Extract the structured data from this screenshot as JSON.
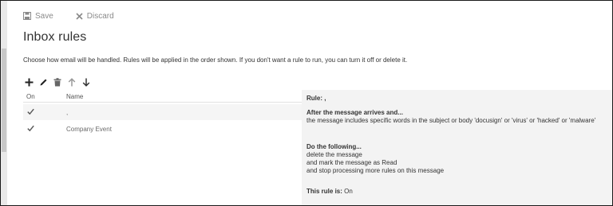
{
  "toolbar": {
    "save_label": "Save",
    "discard_label": "Discard"
  },
  "page": {
    "title": "Inbox rules",
    "description": "Choose how email will be handled. Rules will be applied in the order shown. If you don't want a rule to run, you can turn it off or delete it."
  },
  "rule_actions": {
    "icons": [
      "add-icon",
      "edit-icon",
      "delete-icon",
      "move-up-icon",
      "move-down-icon"
    ]
  },
  "grid": {
    "headers": {
      "on": "On",
      "name": "Name"
    },
    "rows": [
      {
        "on": true,
        "name": ","
      },
      {
        "on": true,
        "name": "Company Event"
      }
    ]
  },
  "detail": {
    "rule_label": "Rule: ,",
    "condition_heading": "After the message arrives and...",
    "condition_text": "the message includes specific words in the subject or body 'docusign' or 'virus' or 'hacked' or 'malware'",
    "action_heading": "Do the following...",
    "actions": [
      "delete the message",
      "and mark the message as Read",
      "and stop processing more rules on this message"
    ],
    "status_label": "This rule is:",
    "status_value": "On"
  },
  "colors": {
    "accent": "#333333",
    "muted": "#8a8a8a",
    "panel_bg": "#f3f3f3",
    "selected_row": "#f5f5f5"
  }
}
